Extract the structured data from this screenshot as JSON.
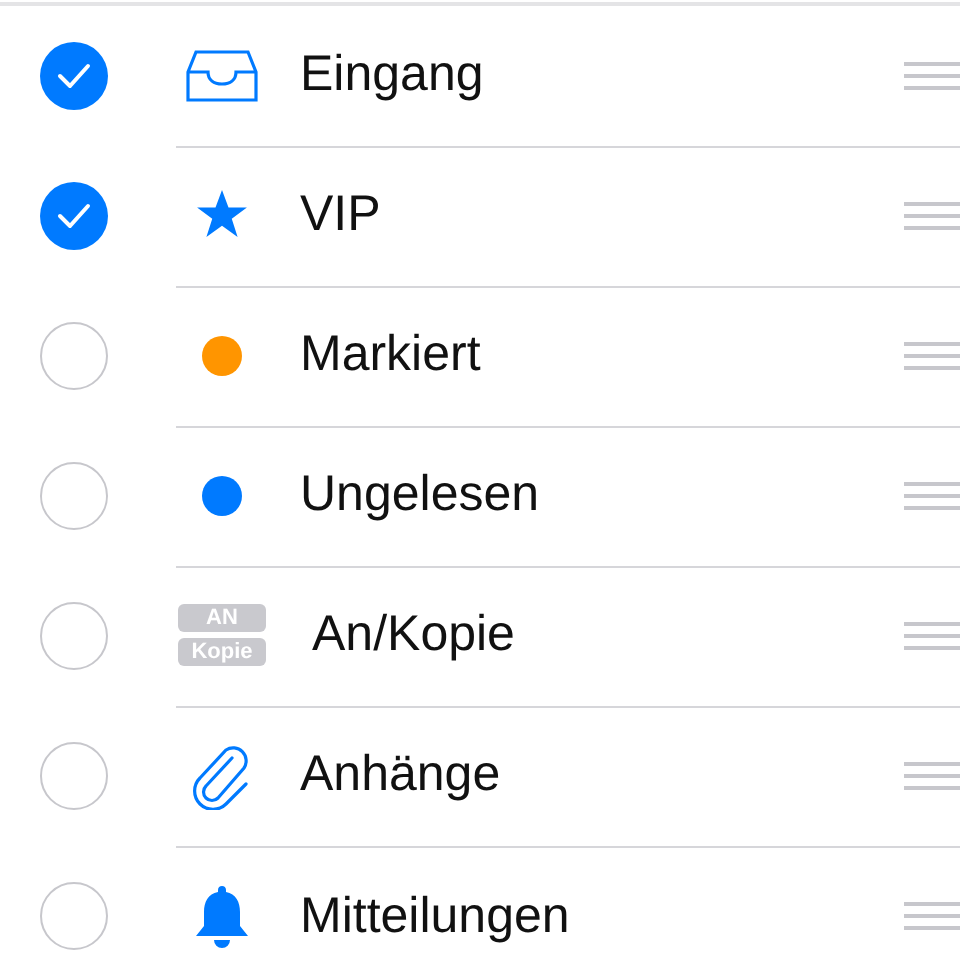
{
  "mailboxes": [
    {
      "label": "Eingang",
      "checked": true,
      "kind": "inbox"
    },
    {
      "label": "VIP",
      "checked": true,
      "kind": "star"
    },
    {
      "label": "Markiert",
      "checked": false,
      "kind": "dot",
      "color": "#ff9500"
    },
    {
      "label": "Ungelesen",
      "checked": false,
      "kind": "dot",
      "color": "#007aff"
    },
    {
      "label": "An/Kopie",
      "checked": false,
      "kind": "badges",
      "badges": [
        "AN",
        "Kopie"
      ]
    },
    {
      "label": "Anhänge",
      "checked": false,
      "kind": "paperclip"
    },
    {
      "label": "Mitteilungen",
      "checked": false,
      "kind": "bell"
    }
  ]
}
